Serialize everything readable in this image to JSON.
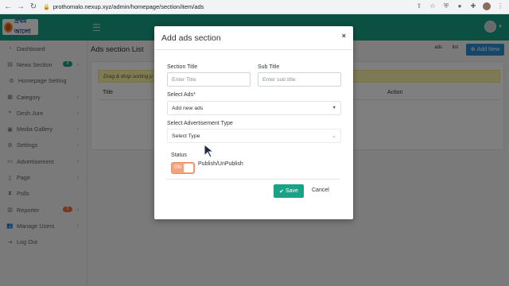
{
  "browser": {
    "url": "prothomalo.nexup.xyz/admin/homepage/section/item/ads"
  },
  "header": {
    "logo_text": "প্রথম আলো"
  },
  "sidebar": {
    "items": [
      {
        "label": "Dashboard",
        "icon": "dashboard-icon"
      },
      {
        "label": "News Section",
        "icon": "news-icon",
        "badge": "8",
        "badge_color": "#17a085"
      },
      {
        "label": "Homepage Setting",
        "icon": "gear-icon"
      },
      {
        "label": "Category",
        "icon": "grid-icon"
      },
      {
        "label": "Desh Jure",
        "icon": "map-icon"
      },
      {
        "label": "Media Gallery",
        "icon": "image-icon"
      },
      {
        "label": "Settings",
        "icon": "gear-icon"
      },
      {
        "label": "Advertisement",
        "icon": "ad-icon"
      },
      {
        "label": "Page",
        "icon": "page-icon"
      },
      {
        "label": "Polls",
        "icon": "hourglass-icon"
      },
      {
        "label": "Reporter",
        "icon": "reporter-icon",
        "badge": "5",
        "badge_color": "#e8703f"
      },
      {
        "label": "Manage Users",
        "icon": "users-icon"
      },
      {
        "label": "Log Out",
        "icon": "logout-icon"
      }
    ]
  },
  "main": {
    "title": "Ads section List",
    "toggle_ads": "ads",
    "toggle_list": "list",
    "add_new": "Add New",
    "notice": "Drag & drop sorting p",
    "columns": [
      "Title",
      "Action"
    ]
  },
  "modal": {
    "title": "Add ads section",
    "close": "×",
    "section_title_label": "Section Title",
    "section_title_placeholder": "Enter Title",
    "sub_title_label": "Sub Title",
    "sub_title_placeholder": "Enter sub title",
    "select_ads_label": "Select Ads*",
    "select_ads_value": "Add new ads",
    "ad_type_label": "Select Advertisement Type",
    "ad_type_value": "Select Type",
    "status_label": "Status",
    "status_switch": "ON",
    "status_text": "Publish/UnPublish",
    "save_label": "Save",
    "cancel_label": "Cancel"
  },
  "colors": {
    "brand": "#17a085",
    "primary": "#2f8fd1",
    "switch_on": "#f5a37e"
  }
}
